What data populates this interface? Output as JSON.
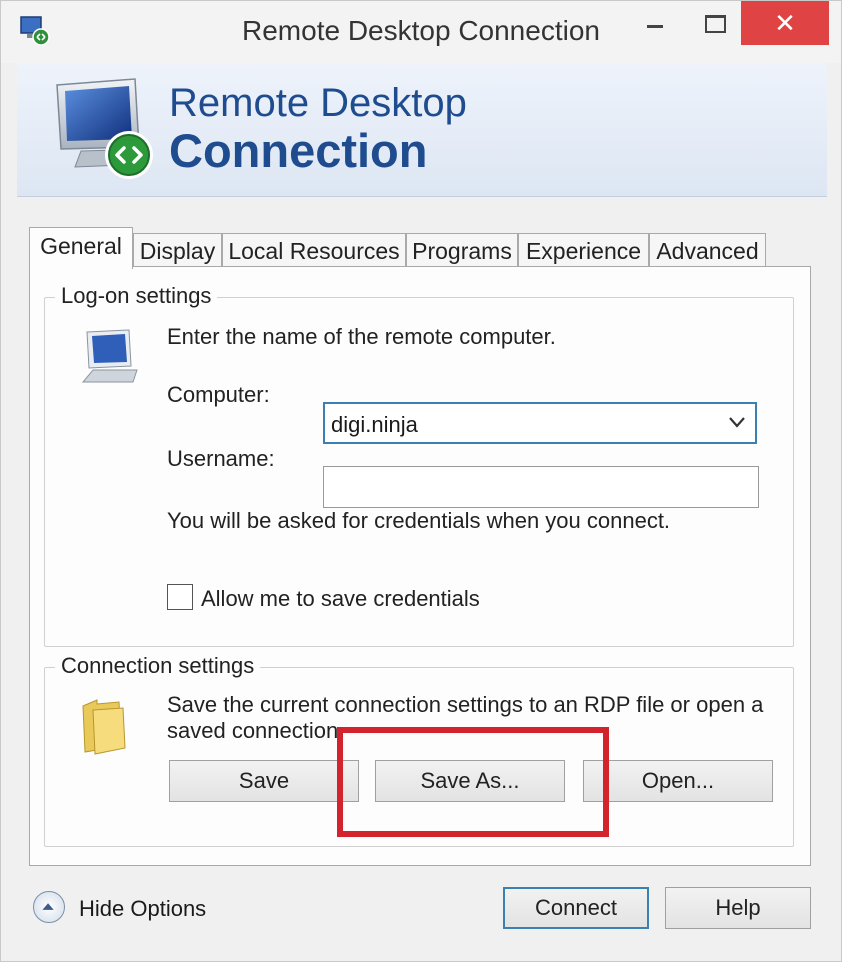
{
  "window": {
    "title": "Remote Desktop Connection",
    "close_glyph": "✕",
    "close_color": "#e04343"
  },
  "banner": {
    "line1": "Remote Desktop",
    "line2": "Connection",
    "text_color": "#1f4c8f"
  },
  "tabs": [
    {
      "label": "General",
      "active": true
    },
    {
      "label": "Display",
      "active": false
    },
    {
      "label": "Local Resources",
      "active": false
    },
    {
      "label": "Programs",
      "active": false
    },
    {
      "label": "Experience",
      "active": false
    },
    {
      "label": "Advanced",
      "active": false
    }
  ],
  "logon": {
    "title": "Log-on settings",
    "instruction": "Enter the name of the remote computer.",
    "computer_label": "Computer:",
    "computer_value": "digi.ninja",
    "username_label": "Username:",
    "username_value": "",
    "credentials_note": "You will be asked for credentials when you connect.",
    "allow_save_label": "Allow me to save credentials",
    "allow_save_checked": false
  },
  "connection": {
    "title": "Connection settings",
    "description_line1": "Save the current connection settings to an RDP file or open a",
    "description_line2": "saved connection.",
    "save_label": "Save",
    "save_as_label": "Save As...",
    "open_label": "Open..."
  },
  "footer": {
    "hide_options_label": "Hide Options",
    "connect_label": "Connect",
    "help_label": "Help"
  },
  "annotation": {
    "highlight_color": "#d3232d",
    "highlight_target": "Save As..."
  }
}
